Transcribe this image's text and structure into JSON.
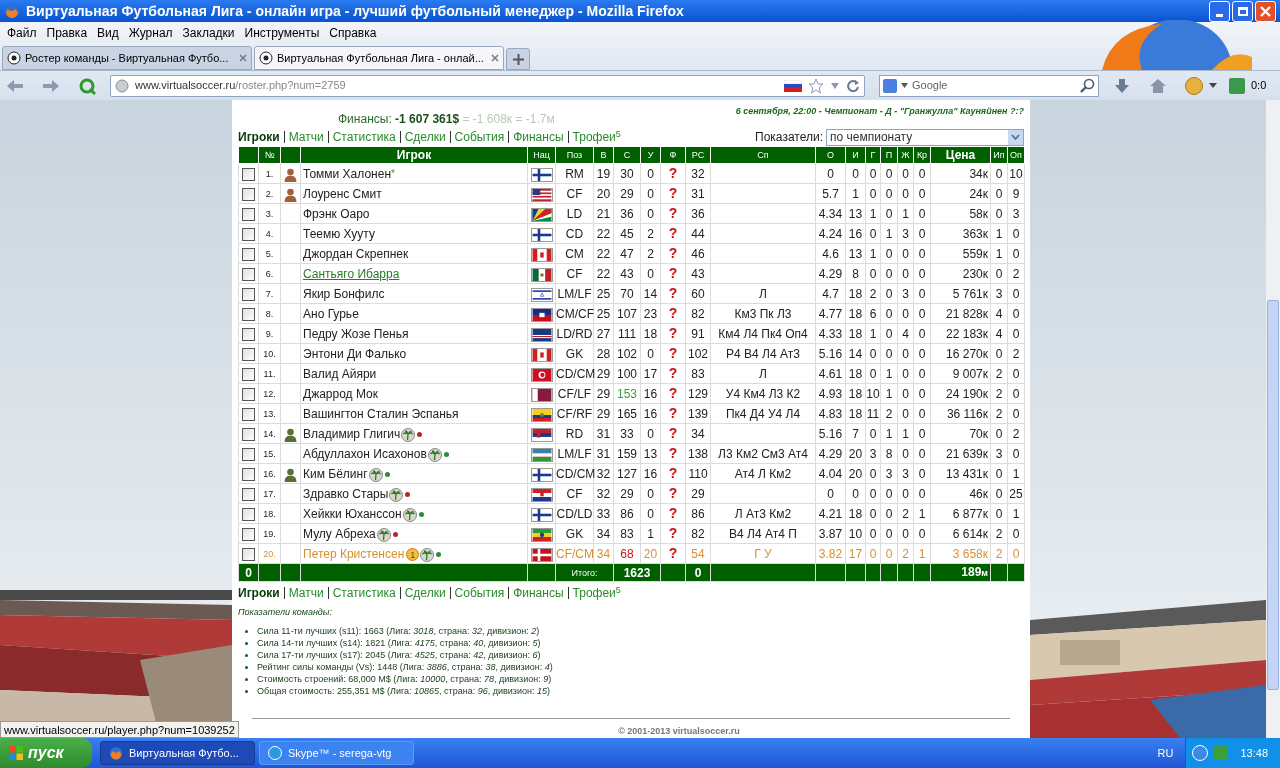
{
  "window": {
    "title": "Виртуальная Футбольная Лига - онлайн игра - лучший футбольный менеджер - Mozilla Firefox"
  },
  "menu": [
    "Файл",
    "Правка",
    "Вид",
    "Журнал",
    "Закладки",
    "Инструменты",
    "Справка"
  ],
  "tabs": [
    {
      "label": "Ростер команды - Виртуальная Футбо...",
      "selected": false
    },
    {
      "label": "Виртуальная Футбольная Лига - онлай...",
      "selected": true
    }
  ],
  "address": {
    "domain": "www.virtualsoccer.ru",
    "path": "/roster.php?num=2759"
  },
  "search": {
    "placeholder": "Google"
  },
  "toolbar_counter": "0:0",
  "finances": {
    "label": "Финансы: ",
    "value": "-1 607 361$",
    "converted": " = -1 608к = -1.7м"
  },
  "next_match": "6 сентября, 22:00 - Чемпионат - Д - \"Гранжулла\" Кауняйнен ?:?",
  "nav_top": [
    {
      "label": "Игроки",
      "selected": true
    },
    {
      "label": "Матчи",
      "selected": false
    },
    {
      "label": "Статистика",
      "selected": false
    },
    {
      "label": "Сделки",
      "selected": false
    },
    {
      "label": "События",
      "selected": false
    },
    {
      "label": "Финансы",
      "selected": false
    },
    {
      "label": "Трофеи$^{5}$",
      "selected": false
    }
  ],
  "indicators": {
    "label": "Показатели:",
    "value": "по чемпионату"
  },
  "columns": [
    "",
    "№",
    "",
    "Игрок",
    "Нац",
    "Поз",
    "В",
    "С",
    "У",
    "Ф",
    "РС",
    "Сп",
    "О",
    "И",
    "Г",
    "П",
    "Ж",
    "Кр",
    "Цена",
    "Ип",
    "Оп"
  ],
  "rows": [
    {
      "checked": false,
      "num": "1.",
      "avatar": {
        "color": "#a0603c"
      },
      "name": "Томми Халонен",
      "mark": "*",
      "flag": {
        "kind": "fi"
      },
      "pos": "RM",
      "v": "19",
      "c": "30",
      "u": "0",
      "f": "?",
      "rs": "32",
      "o": "0",
      "i": "0",
      "g": "0",
      "p": "0",
      "zh": "0",
      "kr": "0",
      "price": "34к",
      "ip": "0",
      "op": "10"
    },
    {
      "checked": false,
      "num": "2.",
      "avatar": {
        "color": "#a0603c"
      },
      "name": "Лоуренс Смит",
      "flag": {
        "kind": "us"
      },
      "pos": "CF",
      "v": "20",
      "c": "29",
      "u": "0",
      "f": "?",
      "rs": "31",
      "o": "5.7",
      "i": "1",
      "g": "0",
      "p": "0",
      "zh": "0",
      "kr": "0",
      "price": "24к",
      "ip": "0",
      "op": "9"
    },
    {
      "checked": false,
      "num": "3.",
      "name": "Фрэнк Оаро",
      "flag": {
        "kind": "sc"
      },
      "pos": "LD",
      "v": "21",
      "c": "36",
      "u": "0",
      "f": "?",
      "rs": "36",
      "o": "4.34",
      "i": "13",
      "g": "1",
      "p": "0",
      "zh": "1",
      "kr": "0",
      "price": "58к",
      "ip": "0",
      "op": "3"
    },
    {
      "checked": false,
      "num": "4.",
      "name": "Теемю Хууту",
      "flag": {
        "kind": "fi"
      },
      "pos": "CD",
      "v": "22",
      "c": "45",
      "u": "2",
      "f": "?",
      "rs": "44",
      "o": "4.24",
      "i": "16",
      "g": "0",
      "p": "1",
      "zh": "3",
      "kr": "0",
      "price": "363к",
      "ip": "1",
      "op": "0"
    },
    {
      "checked": false,
      "num": "5.",
      "name": "Джордан Скрепнек",
      "flag": {
        "kind": "ca"
      },
      "pos": "CM",
      "v": "22",
      "c": "47",
      "u": "2",
      "f": "?",
      "rs": "46",
      "o": "4.6",
      "i": "13",
      "g": "1",
      "p": "0",
      "zh": "0",
      "kr": "0",
      "price": "559к",
      "ip": "1",
      "op": "0"
    },
    {
      "checked": false,
      "num": "6.",
      "name": "Сантьяго Ибарра",
      "link": true,
      "flag": {
        "kind": "mx"
      },
      "pos": "CF",
      "v": "22",
      "c": "43",
      "u": "0",
      "f": "?",
      "rs": "43",
      "o": "4.29",
      "i": "8",
      "g": "0",
      "p": "0",
      "zh": "0",
      "kr": "0",
      "price": "230к",
      "ip": "0",
      "op": "2"
    },
    {
      "checked": false,
      "num": "7.",
      "name": "Якир Бонфилс",
      "flag": {
        "kind": "il"
      },
      "pos": "LM/LF",
      "v": "25",
      "c": "70",
      "u": "14",
      "f": "?",
      "rs": "60",
      "sp": "Л",
      "o": "4.7",
      "i": "18",
      "g": "2",
      "p": "0",
      "zh": "3",
      "kr": "0",
      "price": "5 761к",
      "ip": "3",
      "op": "0"
    },
    {
      "checked": false,
      "num": "8.",
      "name": "Ано Гурье",
      "flag": {
        "kind": "ht"
      },
      "pos": "CM/CF",
      "v": "25",
      "c": "107",
      "u": "23",
      "f": "?",
      "rs": "82",
      "sp": "Км3 Пк Л3",
      "o": "4.77",
      "i": "18",
      "g": "6",
      "p": "0",
      "zh": "0",
      "kr": "0",
      "price": "21 828к",
      "ip": "4",
      "op": "0"
    },
    {
      "checked": false,
      "num": "9.",
      "name": "Педру Жозе Пенья",
      "flag": {
        "kind": "cv"
      },
      "pos": "LD/RD",
      "v": "27",
      "c": "111",
      "u": "18",
      "f": "?",
      "rs": "91",
      "sp": "Км4 Л4 Пк4 Оп4",
      "o": "4.33",
      "i": "18",
      "g": "1",
      "p": "0",
      "zh": "4",
      "kr": "0",
      "price": "22 183к",
      "ip": "4",
      "op": "0"
    },
    {
      "checked": false,
      "num": "10.",
      "name": "Энтони Ди Фалько",
      "flag": {
        "kind": "ca"
      },
      "pos": "GK",
      "v": "28",
      "c": "102",
      "u": "0",
      "f": "?",
      "rs": "102",
      "sp": "Р4 В4 Л4 Ат3",
      "o": "5.16",
      "i": "14",
      "g": "0",
      "p": "0",
      "zh": "0",
      "kr": "0",
      "price": "16 270к",
      "ip": "0",
      "op": "2"
    },
    {
      "checked": false,
      "num": "11.",
      "name": "Валид Айяри",
      "flag": {
        "kind": "tn"
      },
      "pos": "CD/CM",
      "v": "29",
      "c": "100",
      "u": "17",
      "f": "?",
      "rs": "83",
      "sp": "Л",
      "o": "4.61",
      "i": "18",
      "g": "0",
      "p": "1",
      "zh": "0",
      "kr": "0",
      "price": "9 007к",
      "ip": "2",
      "op": "0"
    },
    {
      "checked": false,
      "num": "12.",
      "name": "Джаррод Мок",
      "flag": {
        "kind": "qa"
      },
      "pos": "CF/LF",
      "v": "29",
      "c": "153",
      "c_high": true,
      "u": "16",
      "f": "?",
      "rs": "129",
      "sp": "У4 Км4 Л3 К2",
      "o": "4.93",
      "i": "18",
      "g": "10",
      "p": "1",
      "zh": "0",
      "kr": "0",
      "price": "24 190к",
      "ip": "2",
      "op": "0"
    },
    {
      "checked": false,
      "num": "13.",
      "name": "Вашингтон Сталин Эспанья",
      "flag": {
        "kind": "ec"
      },
      "pos": "CF/RF",
      "v": "29",
      "c": "165",
      "u": "16",
      "f": "?",
      "rs": "139",
      "sp": "Пк4 Д4 У4 Л4",
      "o": "4.83",
      "i": "18",
      "g": "11",
      "p": "2",
      "zh": "0",
      "kr": "0",
      "price": "36 116к",
      "ip": "2",
      "op": "0"
    },
    {
      "checked": false,
      "num": "14.",
      "avatar": {
        "color": "#5a6e3a"
      },
      "name": "Владимир Глигич",
      "palm": true,
      "color": "#b02828",
      "flag": {
        "kind": "rs"
      },
      "pos": "RD",
      "v": "31",
      "c": "33",
      "u": "0",
      "f": "?",
      "rs": "34",
      "o": "5.16",
      "i": "7",
      "g": "0",
      "p": "1",
      "zh": "1",
      "kr": "0",
      "price": "70к",
      "ip": "0",
      "op": "2"
    },
    {
      "checked": false,
      "num": "15.",
      "name": "Абдуллахон Исахонов",
      "palm": true,
      "color": "#2e8b3a",
      "flag": {
        "kind": "uz"
      },
      "pos": "LM/LF",
      "v": "31",
      "c": "159",
      "u": "13",
      "f": "?",
      "rs": "138",
      "sp": "Л3 Км2 См3 Ат4",
      "o": "4.29",
      "i": "20",
      "g": "3",
      "p": "8",
      "zh": "0",
      "kr": "0",
      "price": "21 639к",
      "ip": "3",
      "op": "0"
    },
    {
      "checked": false,
      "num": "16.",
      "avatar": {
        "color": "#5a6e3a"
      },
      "name": "Ким Бёлинг",
      "palm": true,
      "color": "#2e8b3a",
      "flag": {
        "kind": "fi"
      },
      "pos": "CD/CM",
      "v": "32",
      "c": "127",
      "u": "16",
      "f": "?",
      "rs": "110",
      "sp": "Ат4 Л Км2",
      "o": "4.04",
      "i": "20",
      "g": "0",
      "p": "3",
      "zh": "3",
      "kr": "0",
      "price": "13 431к",
      "ip": "0",
      "op": "1"
    },
    {
      "checked": false,
      "num": "17.",
      "name": "Здравко Стары",
      "palm": true,
      "color": "#b02828",
      "flag": {
        "kind": "hr"
      },
      "pos": "CF",
      "v": "32",
      "c": "29",
      "u": "0",
      "f": "?",
      "rs": "29",
      "o": "0",
      "i": "0",
      "g": "0",
      "p": "0",
      "zh": "0",
      "kr": "0",
      "price": "46к",
      "ip": "0",
      "op": "25"
    },
    {
      "checked": false,
      "num": "18.",
      "name": "Хейкки Юханссон",
      "palm": true,
      "color": "#2e8b3a",
      "flag": {
        "kind": "fi"
      },
      "pos": "CD/LD",
      "v": "33",
      "c": "86",
      "u": "0",
      "f": "?",
      "rs": "86",
      "sp": "Л Ат3 Км2",
      "o": "4.21",
      "i": "18",
      "g": "0",
      "p": "0",
      "zh": "2",
      "kr": "1",
      "price": "6 877к",
      "ip": "0",
      "op": "1"
    },
    {
      "checked": false,
      "num": "19.",
      "name": "Мулу Абреха",
      "palm": true,
      "color": "#b02828",
      "flag": {
        "kind": "et"
      },
      "pos": "GK",
      "v": "34",
      "c": "83",
      "u": "1",
      "f": "?",
      "rs": "82",
      "sp": "В4 Л4 Ат4 П",
      "o": "3.87",
      "i": "10",
      "g": "0",
      "p": "0",
      "zh": "0",
      "kr": "0",
      "price": "6 614к",
      "ip": "2",
      "op": "0"
    },
    {
      "checked": false,
      "num": "20.",
      "warning": true,
      "name": "Петер Кристенсен",
      "badge": "1",
      "palm": true,
      "color": "#2e8b3a",
      "flag": {
        "kind": "dk"
      },
      "pos": "CF/CM",
      "v": "34",
      "c": "68",
      "c_low": true,
      "u": "20",
      "f": "?",
      "rs": "54",
      "sp": "Г У",
      "o": "3.82",
      "i": "17",
      "g": "0",
      "p": "0",
      "zh": "2",
      "kr": "1",
      "price": "3 658к",
      "ip": "2",
      "op": "0"
    }
  ],
  "totals": {
    "selected": "0",
    "label": "Итого:",
    "c": "1623",
    "f": "0",
    "price": "189",
    "price_unit": "м"
  },
  "nav_bottom": [
    {
      "label": "Игроки",
      "selected": true
    },
    {
      "label": "Матчи",
      "selected": false
    },
    {
      "label": "Статистика",
      "selected": false
    },
    {
      "label": "Сделки",
      "selected": false
    },
    {
      "label": "События",
      "selected": false
    },
    {
      "label": "Финансы",
      "selected": false
    },
    {
      "label": "Трофеи$^{5}$",
      "selected": false
    }
  ],
  "team_stats": {
    "title": "Показатели команды:",
    "items": [
      "Сила 11-ти лучших (s11): 1663 (Лига: *3018*, страна: *32*, дивизион: *2*)",
      "Сила 14-ти лучших (s14): 1821 (Лига: *4175*, страна: *40*, дивизион: *5*)",
      "Сила 17-ти лучших (s17): 2045 (Лига: *4525*, страна: *42*, дивизион: *6*)",
      "Рейтинг силы команды (Vs): 1448 (Лига: *3886*, страна: *38*, дивизион: *4*)",
      "Стоимость строений: 68,000 M$ (Лига: *10000*, страна: *78*, дивизион: *9*)",
      "Общая стоимость: 255,351 M$ (Лига: *10865*, страна: *96*, дивизион: *15*)"
    ]
  },
  "footer": "© 2001-2013 virtualsoccer.ru",
  "status_url": "www.virtualsoccer.ru/player.php?num=1039252",
  "taskbar": {
    "start": "пуск",
    "tasks": [
      {
        "label": "Виртуальная Футбо...",
        "selected": true
      },
      {
        "label": "Skype™ - serega-vtg",
        "selected": false
      }
    ],
    "language": "RU",
    "clock": "13:48"
  }
}
